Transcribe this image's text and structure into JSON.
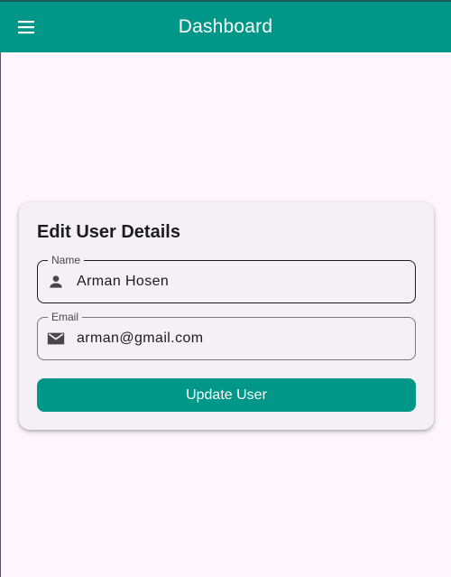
{
  "appbar": {
    "title": "Dashboard",
    "menu_icon": "menu-icon",
    "background": "#009688"
  },
  "form": {
    "title": "Edit User Details",
    "name_field": {
      "label": "Name",
      "value": "Arman Hosen",
      "icon": "person-icon"
    },
    "email_field": {
      "label": "Email",
      "value": "arman@gmail.com",
      "icon": "mail-icon"
    },
    "submit_label": "Update User"
  },
  "colors": {
    "primary": "#009688",
    "background": "#fdf7fd",
    "card": "#f4f0f5",
    "text": "#1d1b20",
    "icon": "#49454f"
  }
}
